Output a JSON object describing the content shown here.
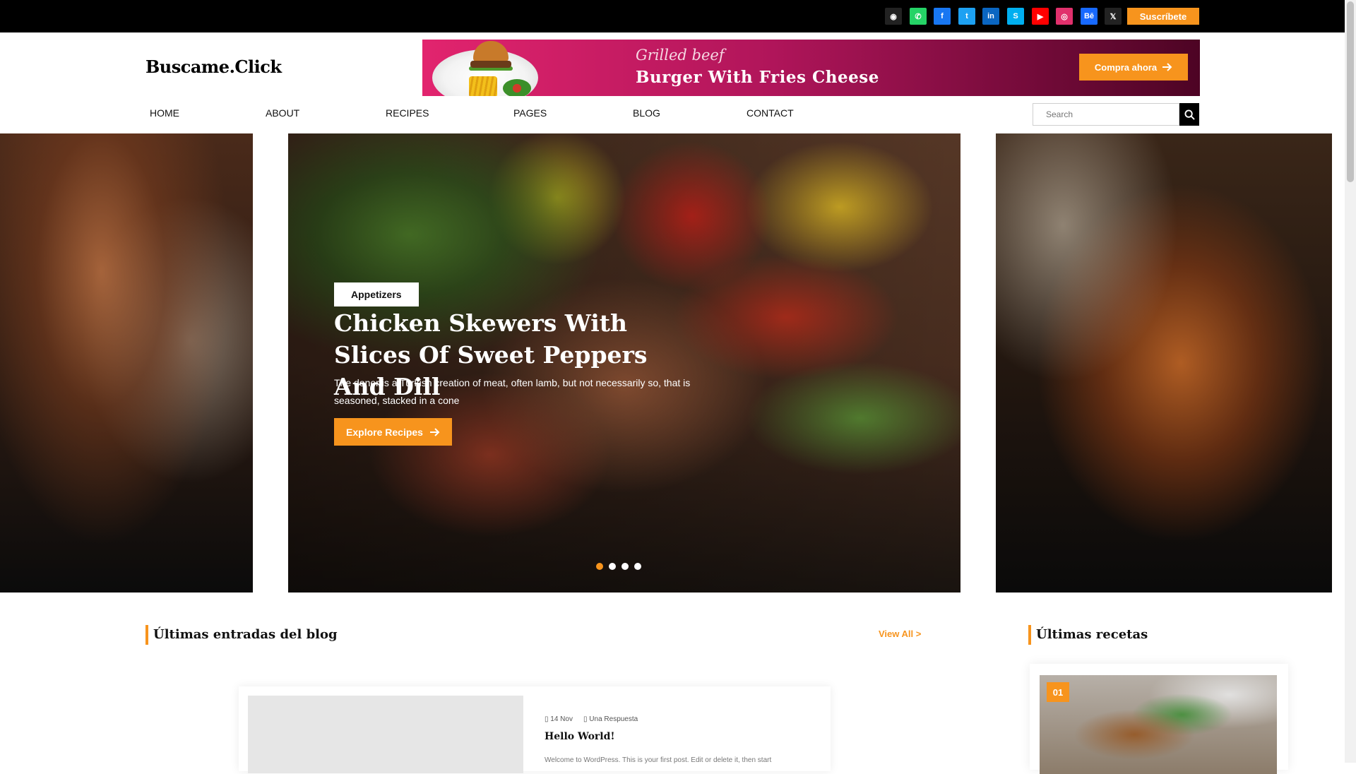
{
  "topbar": {
    "social": [
      {
        "name": "github",
        "glyph": "◉",
        "color": "#222222"
      },
      {
        "name": "whatsapp",
        "glyph": "✆",
        "color": "#25d366"
      },
      {
        "name": "facebook",
        "glyph": "f",
        "color": "#1877f2"
      },
      {
        "name": "twitter",
        "glyph": "t",
        "color": "#1da1f2"
      },
      {
        "name": "linkedin",
        "glyph": "in",
        "color": "#0a66c2"
      },
      {
        "name": "skype",
        "glyph": "S",
        "color": "#00aff0"
      },
      {
        "name": "youtube",
        "glyph": "▶",
        "color": "#ff0000"
      },
      {
        "name": "instagram",
        "glyph": "◎",
        "color": "#e1306c"
      },
      {
        "name": "behance",
        "glyph": "Bē",
        "color": "#1769ff"
      },
      {
        "name": "x",
        "glyph": "𝕏",
        "color": "#222222"
      }
    ],
    "subscribe_label": "Suscríbete"
  },
  "header": {
    "logo": "Buscame.Click",
    "banner": {
      "subtitle": "Grilled beef",
      "title": "Burger With Fries Cheese",
      "button_label": "Compra ahora"
    }
  },
  "nav": {
    "items": [
      "HOME",
      "ABOUT",
      "RECIPES",
      "PAGES",
      "BLOG",
      "CONTACT"
    ],
    "search_placeholder": "Search"
  },
  "slider": {
    "tag": "Appetizers",
    "title": "Chicken Skewers With Slices Of Sweet Peppers And Dill",
    "description": "The doner is a Turkish creation of meat, often lamb, but not necessarily so, that is seasoned, stacked in a cone",
    "button_label": "Explore Recipes",
    "dots": 4,
    "active_dot": 0
  },
  "blog": {
    "title": "Últimas entradas del blog",
    "view_all": "View All >",
    "post": {
      "date": "14 Nov",
      "comments": "Una Respuesta",
      "title": "Hello World!",
      "excerpt": "Welcome to WordPress. This is your first post. Edit or delete it, then start"
    }
  },
  "recipes": {
    "title": "Últimas recetas",
    "first_number": "01"
  },
  "colors": {
    "accent": "#f7941d",
    "banner_start": "#e2246e",
    "banner_end": "#4d0424"
  }
}
